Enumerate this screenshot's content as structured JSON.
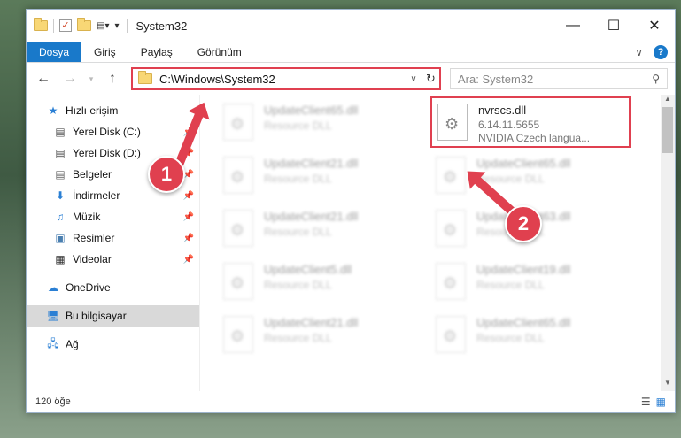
{
  "window": {
    "title": "System32"
  },
  "ribbon": {
    "tabs": [
      "Dosya",
      "Giriş",
      "Paylaş",
      "Görünüm"
    ],
    "expand_icon": "chevron-down-icon",
    "help_label": "?"
  },
  "navbar": {
    "address_path": "C:\\Windows\\System32",
    "search_placeholder": "Ara: System32"
  },
  "sidebar": {
    "quick_access": "Hızlı erişim",
    "items": [
      {
        "label": "Yerel Disk (C:)",
        "icon": "drive-icon"
      },
      {
        "label": "Yerel Disk (D:)",
        "icon": "drive-icon"
      },
      {
        "label": "Belgeler",
        "icon": "documents-icon"
      },
      {
        "label": "İndirmeler",
        "icon": "download-icon"
      },
      {
        "label": "Müzik",
        "icon": "music-icon"
      },
      {
        "label": "Resimler",
        "icon": "pictures-icon"
      },
      {
        "label": "Videolar",
        "icon": "videos-icon"
      }
    ],
    "onedrive": "OneDrive",
    "this_pc": "Bu bilgisayar",
    "network": "Ağ"
  },
  "files": [
    {
      "name": "UpdateClient65.dll",
      "desc": "Resource DLL"
    },
    {
      "name": "nvrscs.dll",
      "version": "6.14.11.5655",
      "desc": "NVIDIA Czech langua..."
    },
    {
      "name": "UpdateClient21.dll",
      "desc": "Resource DLL"
    },
    {
      "name": "UpdateClient65.dll",
      "desc": "Resource DLL"
    },
    {
      "name": "UpdateClient21.dll",
      "desc": "Resource DLL"
    },
    {
      "name": "UpdateClient63.dll",
      "desc": "Resource DLL"
    },
    {
      "name": "UpdateClient5.dll",
      "desc": "Resource DLL"
    },
    {
      "name": "UpdateClient19.dll",
      "desc": "Resource DLL"
    },
    {
      "name": "UpdateClient21.dll",
      "desc": "Resource DLL"
    },
    {
      "name": "UpdateClient65.dll",
      "desc": "Resource DLL"
    }
  ],
  "status": {
    "count": "120 öğe"
  },
  "callouts": [
    "1",
    "2"
  ],
  "colors": {
    "accent": "#1979ca",
    "highlight": "#e0404f"
  }
}
